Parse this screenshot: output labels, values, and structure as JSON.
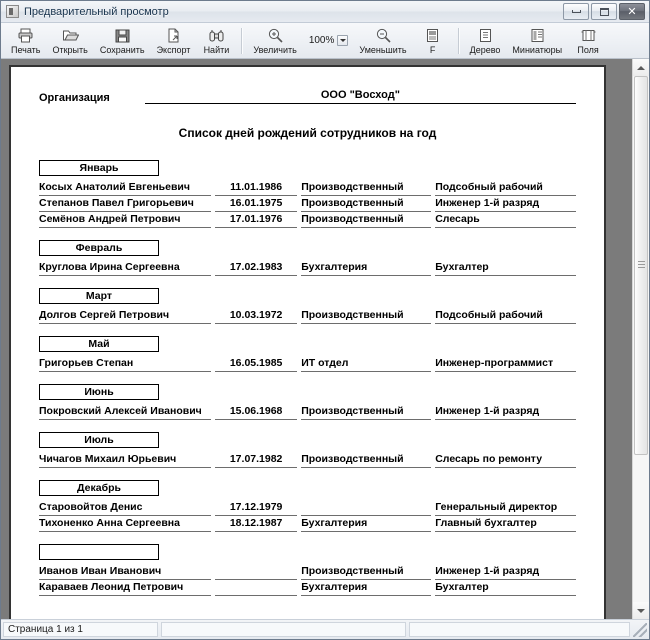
{
  "window": {
    "title": "Предварительный просмотр",
    "app_icon": "document-preview-icon",
    "minimize_label": "",
    "maximize_label": "",
    "close_label": "✕"
  },
  "toolbar": {
    "buttons": [
      {
        "label": "Печать",
        "icon": "printer-icon"
      },
      {
        "label": "Открыть",
        "icon": "folder-open-icon"
      },
      {
        "label": "Сохранить",
        "icon": "floppy-disk-icon"
      },
      {
        "label": "Экспорт",
        "icon": "export-icon"
      },
      {
        "label": "Найти",
        "icon": "binoculars-icon"
      }
    ],
    "buttons2": [
      {
        "label": "Увеличить",
        "icon": "zoom-in-icon"
      }
    ],
    "zoom": {
      "value": "100%",
      "arrow": "chevron-down-icon"
    },
    "buttons3": [
      {
        "label": "Уменьшить",
        "icon": "zoom-out-icon"
      },
      {
        "label": "F",
        "icon": "fit-page-icon"
      }
    ],
    "buttons4": [
      {
        "label": "Дерево",
        "icon": "tree-view-icon"
      },
      {
        "label": "Миниатюры",
        "icon": "thumbnails-icon"
      },
      {
        "label": "Поля",
        "icon": "margins-icon"
      }
    ]
  },
  "statusbar": {
    "page_info": "Страница 1 из 1",
    "panel2": "",
    "panel3": ""
  },
  "document": {
    "org_label": "Организация",
    "org_value": "ООО \"Восход\"",
    "title": "Список дней рождений сотрудников на год",
    "sections": [
      {
        "month": "Январь",
        "rows": [
          {
            "name": "Косых Анатолий Евгеньевич",
            "date": "11.01.1986",
            "dept": "Производственный",
            "position": "Подсобный рабочий"
          },
          {
            "name": "Степанов Павел Григорьевич",
            "date": "16.01.1975",
            "dept": "Производственный",
            "position": "Инженер 1-й разряд"
          },
          {
            "name": "Семёнов Андрей Петрович",
            "date": "17.01.1976",
            "dept": "Производственный",
            "position": "Слесарь"
          }
        ]
      },
      {
        "month": "Февраль",
        "rows": [
          {
            "name": "Круглова Ирина Сергеевна",
            "date": "17.02.1983",
            "dept": "Бухгалтерия",
            "position": "Бухгалтер"
          }
        ]
      },
      {
        "month": "Март",
        "rows": [
          {
            "name": "Долгов Сергей Петрович",
            "date": "10.03.1972",
            "dept": "Производственный",
            "position": "Подсобный рабочий"
          }
        ]
      },
      {
        "month": "Май",
        "rows": [
          {
            "name": "Григорьев Степан",
            "date": "16.05.1985",
            "dept": "ИТ отдел",
            "position": "Инженер-программист"
          }
        ]
      },
      {
        "month": "Июнь",
        "rows": [
          {
            "name": "Покровский Алексей Иванович",
            "date": "15.06.1968",
            "dept": "Производственный",
            "position": "Инженер 1-й разряд"
          }
        ]
      },
      {
        "month": "Июль",
        "rows": [
          {
            "name": "Чичагов Михаил Юрьевич",
            "date": "17.07.1982",
            "dept": "Производственный",
            "position": "Слесарь по ремонту"
          }
        ]
      },
      {
        "month": "Декабрь",
        "rows": [
          {
            "name": "Старовойтов Денис",
            "date": "17.12.1979",
            "dept": "",
            "position": "Генеральный директор"
          },
          {
            "name": "Тихоненко Анна Сергеевна",
            "date": "18.12.1987",
            "dept": "Бухгалтерия",
            "position": "Главный бухгалтер"
          }
        ]
      },
      {
        "month": "",
        "rows": [
          {
            "name": "Иванов Иван Иванович",
            "date": "",
            "dept": "Производственный",
            "position": "Инженер 1-й разряд"
          },
          {
            "name": "Караваев Леонид Петрович",
            "date": "",
            "dept": "Бухгалтерия",
            "position": "Бухгалтер"
          }
        ]
      }
    ]
  }
}
